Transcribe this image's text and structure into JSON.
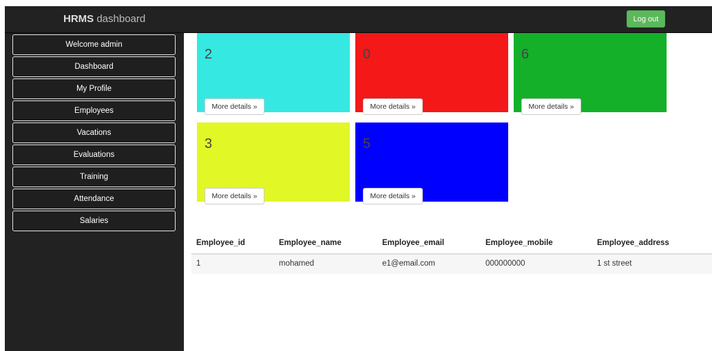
{
  "header": {
    "brand_bold": "HRMS",
    "brand_rest": " dashboard",
    "logout_label": "Log out",
    "logout_color": "#5cb85c"
  },
  "sidebar": {
    "items": [
      {
        "label": "Welcome admin"
      },
      {
        "label": "Dashboard"
      },
      {
        "label": "My Profile"
      },
      {
        "label": "Employees"
      },
      {
        "label": "Vacations"
      },
      {
        "label": "Evaluations"
      },
      {
        "label": "Training"
      },
      {
        "label": "Attendance"
      },
      {
        "label": "Salaries"
      }
    ]
  },
  "cards": [
    {
      "count": "2",
      "button_label": "More details »",
      "color": "#36e8e2"
    },
    {
      "count": "0",
      "button_label": "More details »",
      "color": "#f41818"
    },
    {
      "count": "6",
      "button_label": "More details »",
      "color": "#14b02a"
    },
    {
      "count": "3",
      "button_label": "More details »",
      "color": "#e2f726"
    },
    {
      "count": "5",
      "button_label": "More details »",
      "color": "#0000ff"
    }
  ],
  "table": {
    "headers": [
      "Employee_id",
      "Employee_name",
      "Employee_email",
      "Employee_mobile",
      "Employee_address"
    ],
    "rows": [
      [
        "1",
        "mohamed",
        "e1@email.com",
        "000000000",
        "1 st street"
      ]
    ]
  }
}
